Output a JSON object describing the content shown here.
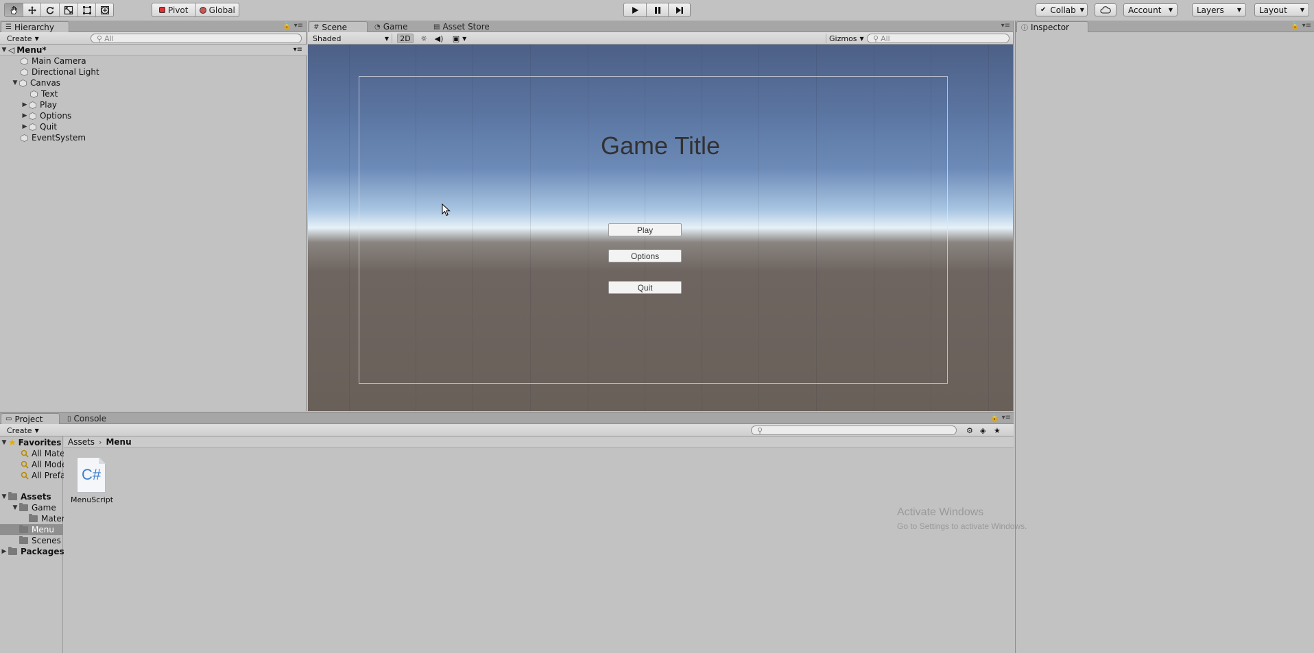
{
  "toolbar": {
    "pivot_label": "Pivot",
    "global_label": "Global",
    "collab_label": "Collab",
    "account_label": "Account",
    "layers_label": "Layers",
    "layout_label": "Layout",
    "tools": [
      "hand-tool",
      "move-tool",
      "rotate-tool",
      "scale-tool",
      "rect-tool",
      "transform-tool"
    ],
    "active_tool": "hand-tool"
  },
  "hierarchy": {
    "tab_label": "Hierarchy",
    "create_label": "Create",
    "search_placeholder": "All",
    "scene_name": "Menu*",
    "items": [
      {
        "label": "Main Camera"
      },
      {
        "label": "Directional Light"
      },
      {
        "label": "Canvas"
      },
      {
        "label": "Text"
      },
      {
        "label": "Play"
      },
      {
        "label": "Options"
      },
      {
        "label": "Quit"
      },
      {
        "label": "EventSystem"
      }
    ]
  },
  "scene": {
    "tabs": [
      {
        "label": "Scene"
      },
      {
        "label": "Game"
      },
      {
        "label": "Asset Store"
      }
    ],
    "shading_mode": "Shaded",
    "mode_2d_label": "2D",
    "gizmos_label": "Gizmos",
    "search_placeholder": "All",
    "game_title": "Game Title",
    "buttons": [
      {
        "label": "Play"
      },
      {
        "label": "Options"
      },
      {
        "label": "Quit"
      }
    ]
  },
  "inspector": {
    "tab_label": "Inspector"
  },
  "project": {
    "tabs": [
      {
        "label": "Project"
      },
      {
        "label": "Console"
      }
    ],
    "create_label": "Create",
    "breadcrumb": [
      "Assets",
      "Menu"
    ],
    "favorites_label": "Favorites",
    "favorites": [
      {
        "label": "All Materials"
      },
      {
        "label": "All Models"
      },
      {
        "label": "All Prefabs"
      }
    ],
    "assets_label": "Assets",
    "folders": [
      {
        "label": "Game"
      },
      {
        "label": "Material"
      },
      {
        "label": "Menu"
      },
      {
        "label": "Scenes"
      }
    ],
    "packages_label": "Packages",
    "files": [
      {
        "name": "MenuScript",
        "icon_text": "C#"
      }
    ]
  },
  "watermark": {
    "line1": "Activate Windows",
    "line2": "Go to Settings to activate Windows."
  },
  "colors": {
    "editor_bg": "#c2c2c2",
    "selection": "#8f8f8f",
    "csharp_icon": "#3a7fd0"
  }
}
